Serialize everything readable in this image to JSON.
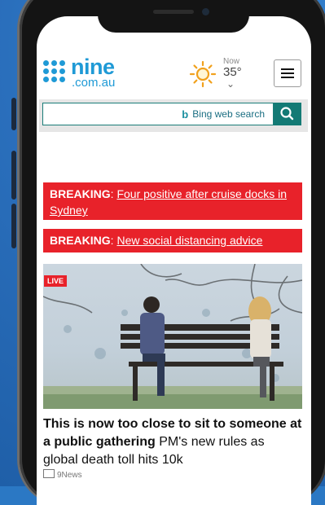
{
  "brand": {
    "name": "nine",
    "domain": ".com.au",
    "color": "#1f9ad6"
  },
  "weather": {
    "label": "Now",
    "temperature": "35°",
    "icon": "sun-icon"
  },
  "search": {
    "placeholder": "Bing web search",
    "icon": "search-icon"
  },
  "breaking": [
    {
      "tag": "BREAKING",
      "headline": "Four positive after cruise docks in Sydney"
    },
    {
      "tag": "BREAKING",
      "headline": "New social distancing advice"
    }
  ],
  "article": {
    "live_label": "LIVE",
    "title_bold": "This is now too close to sit to someone at a public gathering",
    "title_rest": " PM's new rules as global death toll hits 10k",
    "source": "9News"
  },
  "colors": {
    "breaking_red": "#e8222a",
    "search_teal": "#137a75",
    "background_blue": "#2b78c4"
  }
}
